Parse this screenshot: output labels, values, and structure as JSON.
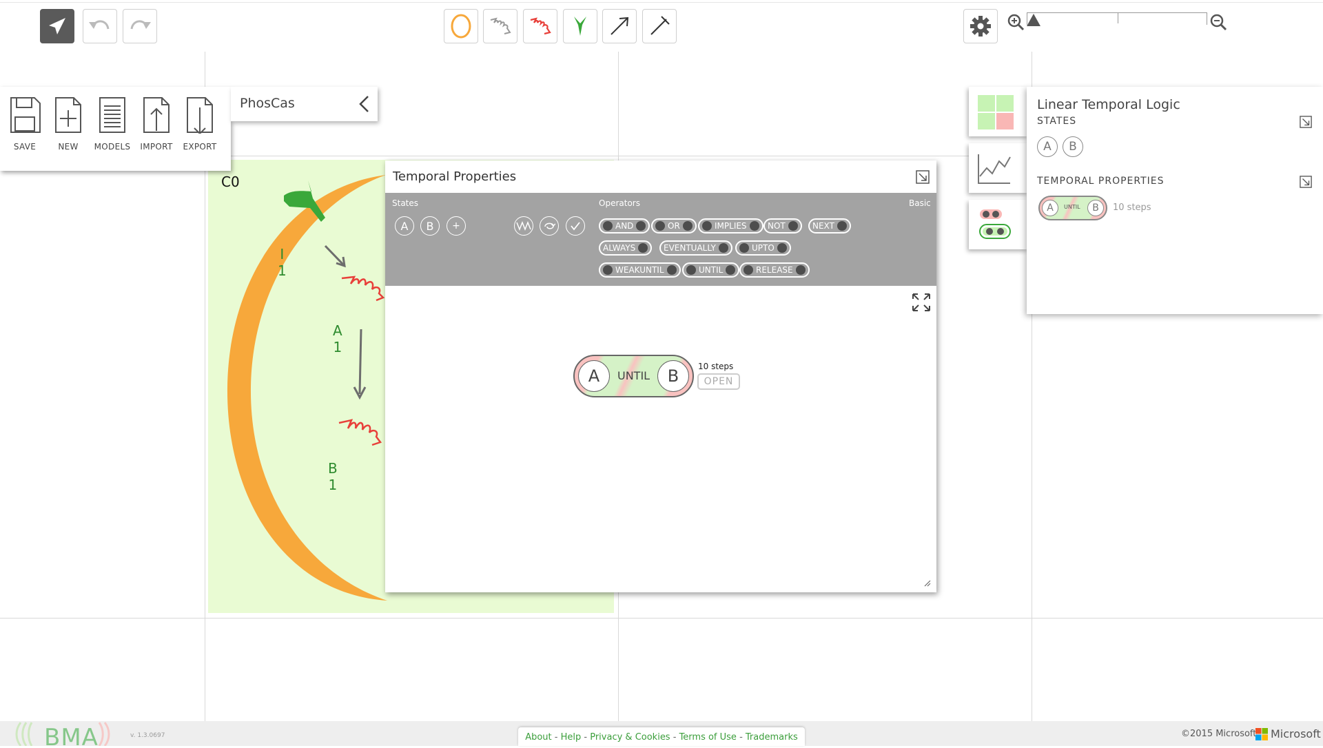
{
  "toolbar": {
    "pointer": "pointer-icon",
    "undo": "undo-icon",
    "redo": "redo-icon",
    "palette": [
      "container-icon",
      "constant-icon",
      "variable-icon",
      "receptor-icon",
      "activator-icon",
      "inhibitor-icon"
    ],
    "settings": "gear-icon",
    "zoom_in": "zoom-in-icon",
    "zoom_out": "zoom-out-icon"
  },
  "file_menu": {
    "items": [
      {
        "label": "SAVE",
        "icon": "save-icon"
      },
      {
        "label": "NEW",
        "icon": "new-icon"
      },
      {
        "label": "MODELS",
        "icon": "models-icon"
      },
      {
        "label": "IMPORT",
        "icon": "import-icon"
      },
      {
        "label": "EXPORT",
        "icon": "export-icon"
      }
    ]
  },
  "model": {
    "name": "PhosCas",
    "cell_label": "C0",
    "variables": [
      {
        "name": "I",
        "value": "1"
      },
      {
        "name": "A",
        "value": "1"
      },
      {
        "name": "B",
        "value": "1"
      }
    ]
  },
  "temporal_window": {
    "title": "Temporal Properties",
    "states_label": "States",
    "states": [
      "A",
      "B",
      "+"
    ],
    "operators_label": "Operators",
    "mode": "Basic",
    "operators": [
      [
        "AND",
        "OR",
        "IMPLIES",
        "NOT",
        "NEXT"
      ],
      [
        "ALWAYS",
        "EVENTUALLY",
        "UPTO"
      ],
      [
        "WEAKUNTIL",
        "UNTIL",
        "RELEASE"
      ]
    ],
    "formula": {
      "left": "A",
      "op": "UNTIL",
      "right": "B",
      "steps": "10 steps",
      "open": "OPEN"
    }
  },
  "right_panel": {
    "title": "Linear Temporal Logic",
    "states_label": "STATES",
    "states": [
      "A",
      "B"
    ],
    "props_label": "TEMPORAL PROPERTIES",
    "prop": {
      "left": "A",
      "op": "UNTIL",
      "right": "B",
      "steps": "10 steps"
    }
  },
  "footer": {
    "logo": "BMA",
    "version": "v. 1.3.0697",
    "links": [
      "About",
      "Help",
      "Privacy & Cookies",
      "Terms of Use",
      "Trademarks"
    ],
    "copyright": "©2015 Microsoft",
    "brand": "Microsoft"
  },
  "colors": {
    "accent_green": "#3aa83a",
    "orange": "#f7a83b",
    "red": "#e8403a",
    "cell_bg": "#e9fbd3"
  }
}
